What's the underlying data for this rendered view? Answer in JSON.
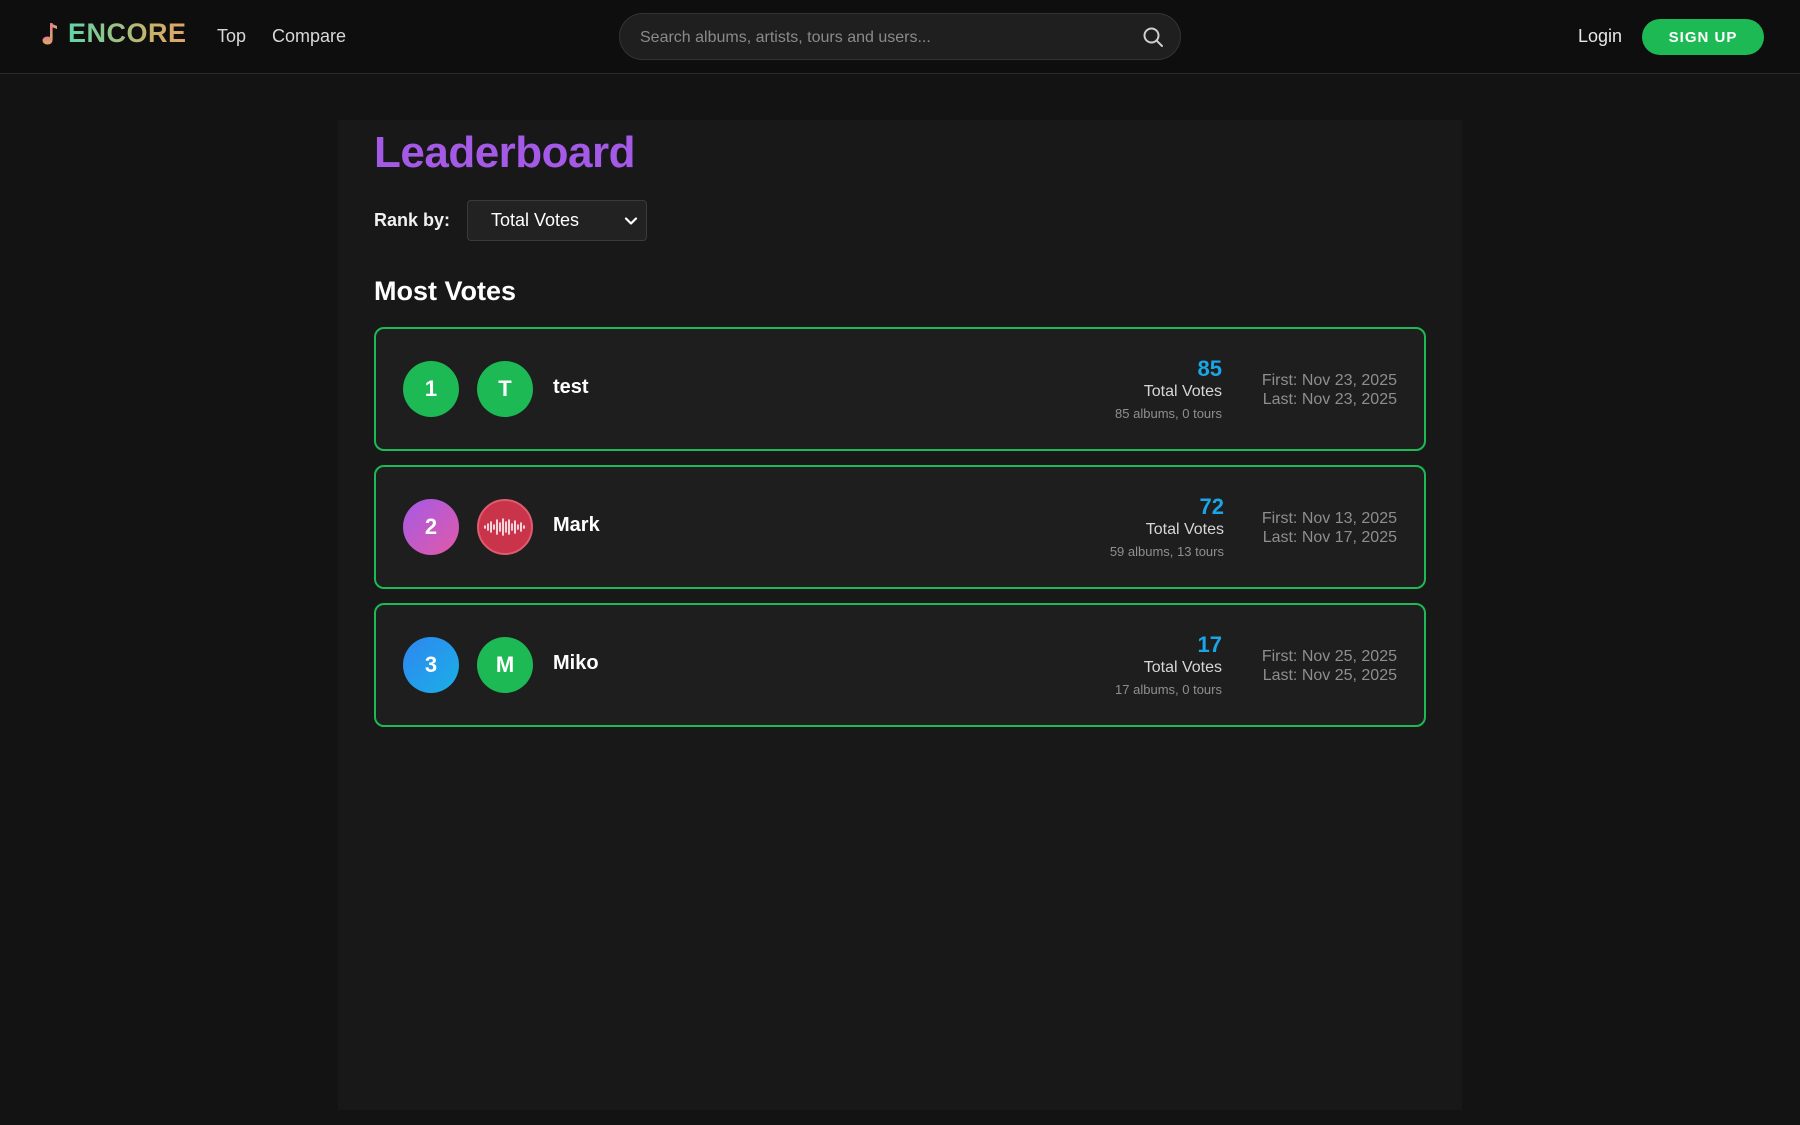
{
  "header": {
    "brand": "ENCORE",
    "nav": [
      "Top",
      "Compare"
    ],
    "search_placeholder": "Search albums, artists, tours and users...",
    "login": "Login",
    "signup": "SIGN UP"
  },
  "page": {
    "title": "Leaderboard",
    "rank_label": "Rank by:",
    "rank_value": "Total Votes",
    "section_title": "Most Votes"
  },
  "leaderboard": [
    {
      "rank": "1",
      "initial": "T",
      "name": "test",
      "votes": "85",
      "votes_label": "Total Votes",
      "breakdown": "85 albums, 0 tours",
      "first": "First: Nov 23, 2025",
      "last": "Last: Nov 23, 2025"
    },
    {
      "rank": "2",
      "initial": "",
      "name": "Mark",
      "votes": "72",
      "votes_label": "Total Votes",
      "breakdown": "59 albums, 13 tours",
      "first": "First: Nov 13, 2025",
      "last": "Last: Nov 17, 2025"
    },
    {
      "rank": "3",
      "initial": "M",
      "name": "Miko",
      "votes": "17",
      "votes_label": "Total Votes",
      "breakdown": "17 albums, 0 tours",
      "first": "First: Nov 25, 2025",
      "last": "Last: Nov 25, 2025"
    }
  ],
  "colors": {
    "accent_green": "#1db954",
    "title_purple": "#a45ae6",
    "votes_blue": "#1aa6e6",
    "rank2_gradient": "#a55ae6-#e05aa8",
    "rank3_gradient": "#2f86f0-#1ab0e6",
    "mark_avatar": "#c9344a"
  },
  "icons": {
    "brand": "music-note-icon",
    "search": "search-icon",
    "select": "chevron-down-icon",
    "mark_avatar": "soundwave-icon"
  }
}
